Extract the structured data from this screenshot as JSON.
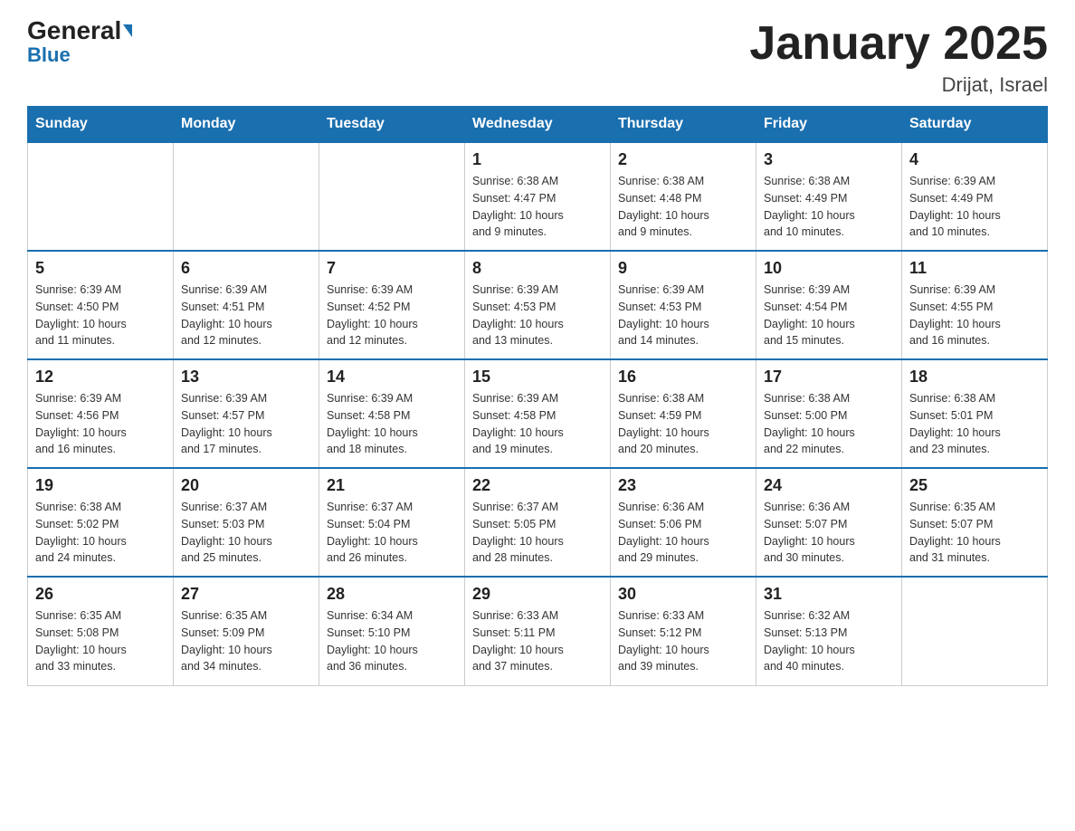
{
  "header": {
    "logo_general": "General",
    "logo_blue": "Blue",
    "main_title": "January 2025",
    "subtitle": "Drijat, Israel"
  },
  "days_of_week": [
    "Sunday",
    "Monday",
    "Tuesday",
    "Wednesday",
    "Thursday",
    "Friday",
    "Saturday"
  ],
  "weeks": [
    [
      {
        "day": "",
        "info": ""
      },
      {
        "day": "",
        "info": ""
      },
      {
        "day": "",
        "info": ""
      },
      {
        "day": "1",
        "info": "Sunrise: 6:38 AM\nSunset: 4:47 PM\nDaylight: 10 hours\nand 9 minutes."
      },
      {
        "day": "2",
        "info": "Sunrise: 6:38 AM\nSunset: 4:48 PM\nDaylight: 10 hours\nand 9 minutes."
      },
      {
        "day": "3",
        "info": "Sunrise: 6:38 AM\nSunset: 4:49 PM\nDaylight: 10 hours\nand 10 minutes."
      },
      {
        "day": "4",
        "info": "Sunrise: 6:39 AM\nSunset: 4:49 PM\nDaylight: 10 hours\nand 10 minutes."
      }
    ],
    [
      {
        "day": "5",
        "info": "Sunrise: 6:39 AM\nSunset: 4:50 PM\nDaylight: 10 hours\nand 11 minutes."
      },
      {
        "day": "6",
        "info": "Sunrise: 6:39 AM\nSunset: 4:51 PM\nDaylight: 10 hours\nand 12 minutes."
      },
      {
        "day": "7",
        "info": "Sunrise: 6:39 AM\nSunset: 4:52 PM\nDaylight: 10 hours\nand 12 minutes."
      },
      {
        "day": "8",
        "info": "Sunrise: 6:39 AM\nSunset: 4:53 PM\nDaylight: 10 hours\nand 13 minutes."
      },
      {
        "day": "9",
        "info": "Sunrise: 6:39 AM\nSunset: 4:53 PM\nDaylight: 10 hours\nand 14 minutes."
      },
      {
        "day": "10",
        "info": "Sunrise: 6:39 AM\nSunset: 4:54 PM\nDaylight: 10 hours\nand 15 minutes."
      },
      {
        "day": "11",
        "info": "Sunrise: 6:39 AM\nSunset: 4:55 PM\nDaylight: 10 hours\nand 16 minutes."
      }
    ],
    [
      {
        "day": "12",
        "info": "Sunrise: 6:39 AM\nSunset: 4:56 PM\nDaylight: 10 hours\nand 16 minutes."
      },
      {
        "day": "13",
        "info": "Sunrise: 6:39 AM\nSunset: 4:57 PM\nDaylight: 10 hours\nand 17 minutes."
      },
      {
        "day": "14",
        "info": "Sunrise: 6:39 AM\nSunset: 4:58 PM\nDaylight: 10 hours\nand 18 minutes."
      },
      {
        "day": "15",
        "info": "Sunrise: 6:39 AM\nSunset: 4:58 PM\nDaylight: 10 hours\nand 19 minutes."
      },
      {
        "day": "16",
        "info": "Sunrise: 6:38 AM\nSunset: 4:59 PM\nDaylight: 10 hours\nand 20 minutes."
      },
      {
        "day": "17",
        "info": "Sunrise: 6:38 AM\nSunset: 5:00 PM\nDaylight: 10 hours\nand 22 minutes."
      },
      {
        "day": "18",
        "info": "Sunrise: 6:38 AM\nSunset: 5:01 PM\nDaylight: 10 hours\nand 23 minutes."
      }
    ],
    [
      {
        "day": "19",
        "info": "Sunrise: 6:38 AM\nSunset: 5:02 PM\nDaylight: 10 hours\nand 24 minutes."
      },
      {
        "day": "20",
        "info": "Sunrise: 6:37 AM\nSunset: 5:03 PM\nDaylight: 10 hours\nand 25 minutes."
      },
      {
        "day": "21",
        "info": "Sunrise: 6:37 AM\nSunset: 5:04 PM\nDaylight: 10 hours\nand 26 minutes."
      },
      {
        "day": "22",
        "info": "Sunrise: 6:37 AM\nSunset: 5:05 PM\nDaylight: 10 hours\nand 28 minutes."
      },
      {
        "day": "23",
        "info": "Sunrise: 6:36 AM\nSunset: 5:06 PM\nDaylight: 10 hours\nand 29 minutes."
      },
      {
        "day": "24",
        "info": "Sunrise: 6:36 AM\nSunset: 5:07 PM\nDaylight: 10 hours\nand 30 minutes."
      },
      {
        "day": "25",
        "info": "Sunrise: 6:35 AM\nSunset: 5:07 PM\nDaylight: 10 hours\nand 31 minutes."
      }
    ],
    [
      {
        "day": "26",
        "info": "Sunrise: 6:35 AM\nSunset: 5:08 PM\nDaylight: 10 hours\nand 33 minutes."
      },
      {
        "day": "27",
        "info": "Sunrise: 6:35 AM\nSunset: 5:09 PM\nDaylight: 10 hours\nand 34 minutes."
      },
      {
        "day": "28",
        "info": "Sunrise: 6:34 AM\nSunset: 5:10 PM\nDaylight: 10 hours\nand 36 minutes."
      },
      {
        "day": "29",
        "info": "Sunrise: 6:33 AM\nSunset: 5:11 PM\nDaylight: 10 hours\nand 37 minutes."
      },
      {
        "day": "30",
        "info": "Sunrise: 6:33 AM\nSunset: 5:12 PM\nDaylight: 10 hours\nand 39 minutes."
      },
      {
        "day": "31",
        "info": "Sunrise: 6:32 AM\nSunset: 5:13 PM\nDaylight: 10 hours\nand 40 minutes."
      },
      {
        "day": "",
        "info": ""
      }
    ]
  ]
}
